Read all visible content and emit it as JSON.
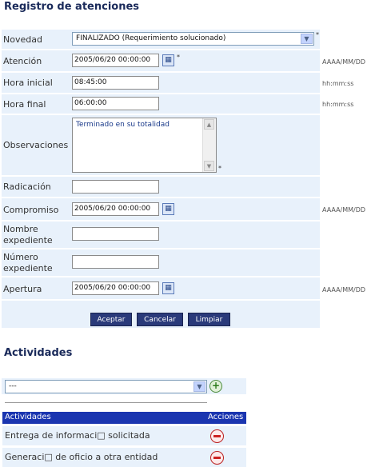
{
  "page_title": "Registro de atenciones",
  "form": {
    "novedad": {
      "label": "Novedad",
      "value": "FINALIZADO (Requerimiento solucionado)",
      "required": "*"
    },
    "atencion": {
      "label": "Atención",
      "value": "2005/06/20 00:00:00",
      "required": "*",
      "format": "AAAA/MM/DD"
    },
    "hora_inicial": {
      "label": "Hora inicial",
      "value": "08:45:00",
      "format": "hh:mm:ss"
    },
    "hora_final": {
      "label": "Hora final",
      "value": "06:00:00",
      "format": "hh:mm:ss"
    },
    "observaciones": {
      "label": "Observaciones",
      "value": "Terminado en su totalidad",
      "required": "*"
    },
    "radicacion": {
      "label": "Radicación",
      "value": ""
    },
    "compromiso": {
      "label": "Compromiso",
      "value": "2005/06/20 00:00:00",
      "format": "AAAA/MM/DD"
    },
    "nombre_expediente": {
      "label_line1": "Nombre",
      "label_line2": "expediente",
      "value": ""
    },
    "numero_expediente": {
      "label_line1": "Número",
      "label_line2": "expediente",
      "value": ""
    },
    "apertura": {
      "label": "Apertura",
      "value": "2005/06/20 00:00:00",
      "format": "AAAA/MM/DD"
    }
  },
  "buttons": {
    "aceptar": "Aceptar",
    "cancelar": "Cancelar",
    "limpiar": "Limpiar"
  },
  "actividades": {
    "title": "Actividades",
    "select_value": "---",
    "headers": {
      "actividades": "Actividades",
      "acciones": "Acciones"
    },
    "rows": [
      {
        "label": "Entrega de informaci□ solicitada"
      },
      {
        "label": "Generaci□ de oficio a otra entidad"
      }
    ]
  }
}
